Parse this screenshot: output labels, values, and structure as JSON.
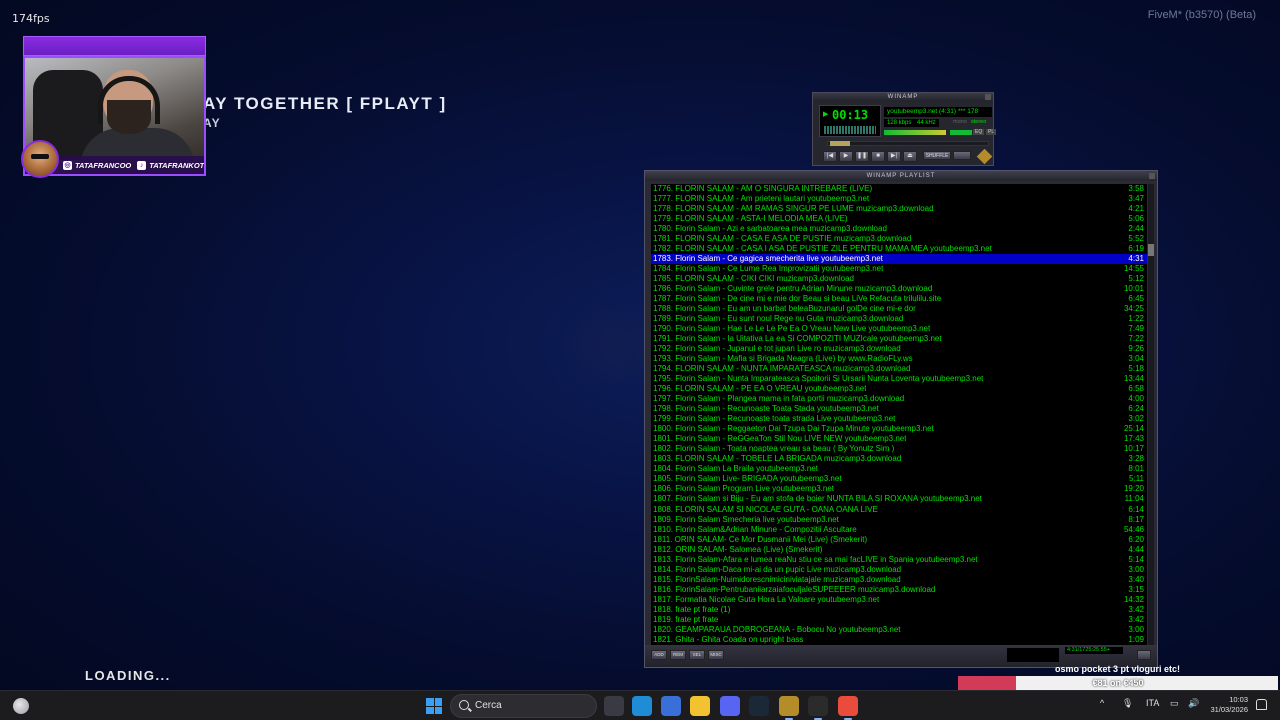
{
  "overlay": {
    "fps": "174fps",
    "fivem_build": "FiveM* (b3570) (Beta)",
    "server_title": "AY TOGETHER [ FPLAYT ]",
    "server_sub": "AY",
    "loading": "LOADING..."
  },
  "webcam": {
    "instagram": "TATAFRANCOO",
    "tiktok": "TATAFRANKOTV"
  },
  "winamp": {
    "title": "WINAMP",
    "time": "00:13",
    "song": "youtubeemp3.net (4:31) *** 178",
    "kbps": "128 kbps",
    "khz": "44 kHz",
    "mono": "mono",
    "stereo": "stereo",
    "eq": "EQ",
    "pl": "PL",
    "controls": [
      "|◀",
      "▶",
      "❚❚",
      "■",
      "▶|"
    ],
    "eject": "⏏",
    "shuffle": "SHUFFLE",
    "playlist_title": "WINAMP PLAYLIST",
    "playlist_info": "4:31/1725:25:55+",
    "bottom_buttons": [
      "ADD",
      "REM",
      "SEL",
      "MISC"
    ],
    "selected_index": 7,
    "tracks": [
      {
        "t": "1776. FLORIN SALAM - AM O SINGURA INTREBARE (LIVE)",
        "d": "3:58"
      },
      {
        "t": "1777. FLORIN SALAM - Am prieteni lautari youtubeemp3.net",
        "d": "3:47"
      },
      {
        "t": "1778. FLORIN SALAM - AM RAMAS SINGUR PE LUME muzicamp3.download",
        "d": "4:21"
      },
      {
        "t": "1779. FLORIN SALAM - ASTA-I MELODIA MEA (LIVE)",
        "d": "5:06"
      },
      {
        "t": "1780. Florin Salam - Azi e sarbatoarea mea muzicamp3.download",
        "d": "2:44"
      },
      {
        "t": "1781. FLORIN SALAM - CASA E ASA DE PUSTIE muzicamp3.download",
        "d": "5:52"
      },
      {
        "t": "1782. FLORIN SALAM - CASA I ASA DE PUSTIE ZILE PENTRU MAMA MEA youtubeemp3.net",
        "d": "6:19"
      },
      {
        "t": "1783. Florin Salam - Ce gagica smecherita live youtubeemp3.net",
        "d": "4:31"
      },
      {
        "t": "1784. Florin Salam - Ce Lume Rea Improvizatii youtubeemp3.net",
        "d": "14:55"
      },
      {
        "t": "1785. FLORIN SALAM - CIKI CIKI muzicamp3.download",
        "d": "5:12"
      },
      {
        "t": "1786. Florin Salam - Cuvinte grele pentru Adrian Minune muzicamp3.download",
        "d": "10:01"
      },
      {
        "t": "1787. Florin Salam - De cine mi e mie dor  Beau si beau      LiVe   Refacuta trilulilu.site",
        "d": "6:45"
      },
      {
        "t": "1788. Florin Salam - Eu am un barbat beleaBuzunarul golDe cine mi-e dor",
        "d": "34:25"
      },
      {
        "t": "1789. Florin Salam - Eu sunt noul Rege nu Guta muzicamp3.download",
        "d": "1:22"
      },
      {
        "t": "1790. Florin Salam - Hae Le Le Le Pe Ea O Vreau New Live youtubeemp3.net",
        "d": "7:49"
      },
      {
        "t": "1791. Florin Salam - Ia Uitativa La ea Si COMPOZITI MUZIcale youtubeemp3.net",
        "d": "7:22"
      },
      {
        "t": "1792. Florin Salam - Jupanul e tot jupan Live  ro muzicamp3.download",
        "d": "9:26"
      },
      {
        "t": "1793. Florin Salam - Mafia si Brigada Neagra (Live) by www.RadioFLy.ws",
        "d": "3:04"
      },
      {
        "t": "1794. FLORIN SALAM - NUNTA IMPARATEASCA muzicamp3.download",
        "d": "5:18"
      },
      {
        "t": "1795. Florin Salam - Nunta Imparateasca Spoitorii Si Ursarii  Nunta Loventa youtubeemp3.net",
        "d": "13:44"
      },
      {
        "t": "1796. FLORIN SALAM - PE EA O VREAU youtubeemp3.net",
        "d": "6:58"
      },
      {
        "t": "1797. Florin Salam - Plangea mama in fata portii muzicamp3.download",
        "d": "4:00"
      },
      {
        "t": "1798. Florin Salam - Recunoaste Toata Stada youtubeemp3.net",
        "d": "6:24"
      },
      {
        "t": "1799. Florin Salam - Recunoaste toata strada   Live youtubeemp3.net",
        "d": "3:02"
      },
      {
        "t": "1800. Florin Salam - Reggaeton  Dai Tzupa Dai Tzupa  Minute youtubeemp3.net",
        "d": "25:14"
      },
      {
        "t": "1801. Florin Salam - ReGGeaTon Stil Nou LIVE NEW youtubeemp3.net",
        "d": "17:43"
      },
      {
        "t": "1802. Florin Salam - Toata noaptea vreau sa beau ( By Yonutz Sim )",
        "d": "10:17"
      },
      {
        "t": "1803. FLORIN SALAM - TOBELE LA BRIGADA muzicamp3.download",
        "d": "3:28"
      },
      {
        "t": "1804. Florin Salam La Braila youtubeemp3.net",
        "d": "8:01"
      },
      {
        "t": "1805. Florin Salam Live- BRIGADA youtubeemp3.net",
        "d": "5:11"
      },
      {
        "t": "1806. Florin Salam Program Live youtubeemp3.net",
        "d": "19:20"
      },
      {
        "t": "1807. Florin Salam si Biju - Eu am stofa de boier NUNTA BILA SI ROXANA youtubeemp3.net",
        "d": "11:04"
      },
      {
        "t": "1808. FLORIN SALAM SI NICOLAE GUTA - OANA OANA LIVE",
        "d": "6:14"
      },
      {
        "t": "1809. Florin Salam Smecheria live youtubeemp3.net",
        "d": "8:17"
      },
      {
        "t": "1810. Florin Salam&Adrian Minune - Compozitii Ascultare",
        "d": "54:46"
      },
      {
        "t": "1811. ORIN SALAM- Ce Mor Dusmanii Mei (Live) (Smekerit)",
        "d": "6:20"
      },
      {
        "t": "1812. ORIN SALAM- Salomea (Live) (Smekerit)",
        "d": "4:44"
      },
      {
        "t": "1813. Florin Salam-Afara e lumea reaNu stiu ce sa mai facLIVE in Spania youtubeemp3.net",
        "d": "5:14"
      },
      {
        "t": "1814. Florin Salam-Daca mi-ai da un pupic Live muzicamp3.download",
        "d": "3:00"
      },
      {
        "t": "1815. FlorinSalam-Nuimidorescnimiciniviatajale muzicamp3.download",
        "d": "3:40"
      },
      {
        "t": "1816. FlorinSalam-PentrubaniiarzaiafoculjaleSUPEEEER muzicamp3.download",
        "d": "3:15"
      },
      {
        "t": "1817. Formatia Nicolae Guta Hora La Valoare youtubeemp3.net",
        "d": "14:32"
      },
      {
        "t": "1818. frate pt frate (1)",
        "d": "3:42"
      },
      {
        "t": "1819. frate pt frate",
        "d": "3:42"
      },
      {
        "t": "1820. GEAMPARAUA DOBROGEANA - Bobocu No youtubeemp3.net",
        "d": "3:00"
      },
      {
        "t": "1821. Ghita - Ghita Coada on upright bass",
        "d": "1:09"
      }
    ]
  },
  "donation": {
    "text": "osmo pocket 3 pt vloguri etc!",
    "amount": "€81 on €450",
    "progress": 0.18,
    "fill_color": "#d23b58"
  },
  "taskbar": {
    "search_label": "Cerca",
    "language": "ITA",
    "time": "10:03",
    "date": "31/03/2026",
    "tray_up": "^",
    "apps": [
      {
        "name": "task-view-icon",
        "color": "#3a3a45"
      },
      {
        "name": "edge-icon",
        "color": "#1f8dd6"
      },
      {
        "name": "store-icon",
        "color": "#3b6fd8"
      },
      {
        "name": "file-explorer-icon",
        "color": "#f2c230"
      },
      {
        "name": "discord-icon",
        "color": "#5865f2"
      },
      {
        "name": "steam-icon",
        "color": "#1b2838"
      },
      {
        "name": "winamp-icon",
        "color": "#b58c2a"
      },
      {
        "name": "obs-icon",
        "color": "#2b2b2b"
      },
      {
        "name": "fivem-icon",
        "color": "#e94b3c"
      }
    ]
  }
}
